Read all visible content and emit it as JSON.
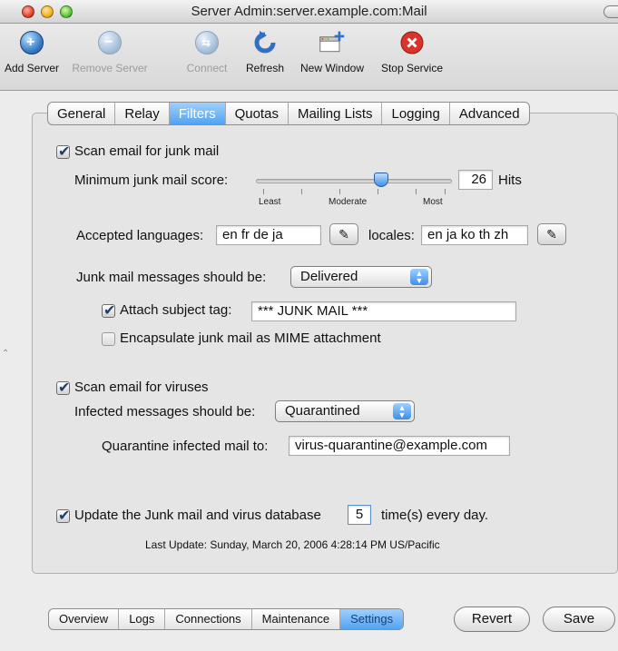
{
  "window": {
    "title": "Server Admin:server.example.com:Mail"
  },
  "toolbar": {
    "items": [
      {
        "label": "Add Server",
        "icon": "add-server-globe-icon",
        "enabled": true
      },
      {
        "label": "Remove Server",
        "icon": "remove-server-globe-icon",
        "enabled": false
      },
      {
        "label": "Connect",
        "icon": "connect-globe-icon",
        "enabled": false
      },
      {
        "label": "Refresh",
        "icon": "refresh-icon",
        "enabled": true
      },
      {
        "label": "New Window",
        "icon": "new-window-icon",
        "enabled": true
      },
      {
        "label": "Stop Service",
        "icon": "stop-service-icon",
        "enabled": true
      }
    ]
  },
  "tabs": [
    "General",
    "Relay",
    "Filters",
    "Quotas",
    "Mailing Lists",
    "Logging",
    "Advanced"
  ],
  "active_tab": "Filters",
  "junk": {
    "scan_label": "Scan email for junk mail",
    "scan_checked": true,
    "min_score_label": "Minimum junk mail score:",
    "score_value": "26",
    "score_unit": "Hits",
    "slider_labels": [
      "Least",
      "Moderate",
      "Most"
    ],
    "slider_level": 0.65,
    "accepted_languages_label": "Accepted languages:",
    "accepted_languages_value": "en fr de ja",
    "locales_label": "locales:",
    "locales_value": "en ja ko th zh",
    "messages_label": "Junk mail messages should be:",
    "messages_option": "Delivered",
    "attach_tag_label": "Attach subject tag:",
    "attach_tag_checked": true,
    "attach_tag_value": "*** JUNK MAIL ***",
    "encapsulate_label": "Encapsulate junk mail as MIME attachment",
    "encapsulate_checked": false
  },
  "virus": {
    "scan_label": "Scan email for viruses",
    "scan_checked": true,
    "infected_label": "Infected messages should be:",
    "infected_option": "Quarantined",
    "quarantine_label": "Quarantine infected mail to:",
    "quarantine_value": "virus-quarantine@example.com"
  },
  "update": {
    "label_before": "Update the Junk mail and virus database",
    "times_value": "5",
    "label_after": "time(s) every day.",
    "checked": true,
    "last_update": "Last Update: Sunday, March 20, 2006 4:28:14 PM US/Pacific"
  },
  "bottom_tabs": [
    "Overview",
    "Logs",
    "Connections",
    "Maintenance",
    "Settings"
  ],
  "bottom_active": "Settings",
  "buttons": {
    "revert": "Revert",
    "save": "Save"
  },
  "colors": {
    "accent": "#4c9ff0",
    "close": "#e0442e",
    "minimize": "#f0b020",
    "zoom": "#5cc63a",
    "stop": "#d9342b",
    "refresh": "#2f6fc4"
  }
}
